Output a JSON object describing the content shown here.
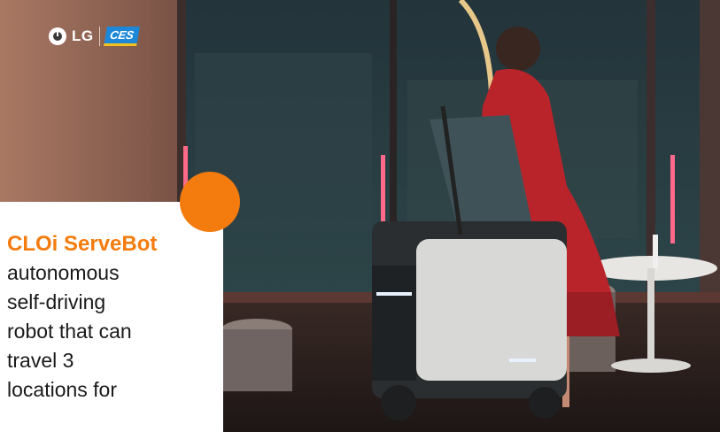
{
  "brand": {
    "company": "LG",
    "event": "CES"
  },
  "card": {
    "title": "CLOi ServeBot",
    "lines": [
      "autonomous",
      "self-driving",
      "robot that can",
      "travel 3",
      "locations for"
    ]
  },
  "colors": {
    "accent": "#f47c0f",
    "text": "#1a1a1a",
    "ces_blue": "#1e88d8"
  }
}
